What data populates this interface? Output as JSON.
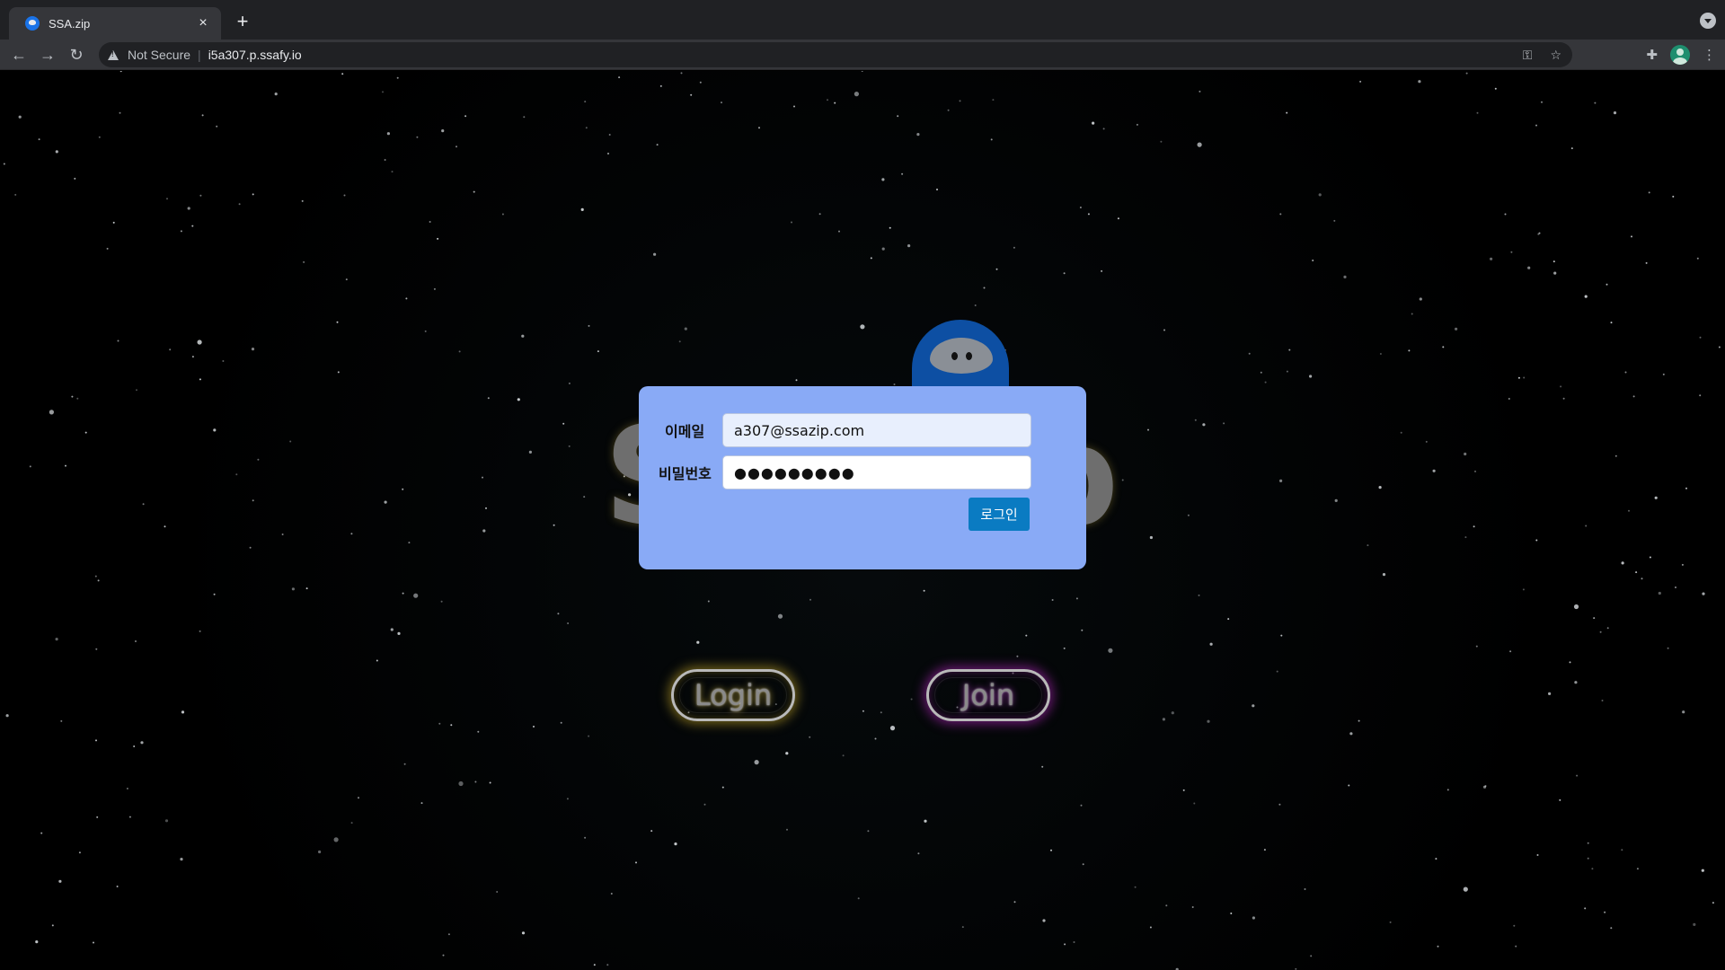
{
  "browser": {
    "tab_title": "SSA.zip",
    "tab_close": "×",
    "new_tab": "+",
    "security_label": "Not Secure",
    "url": "i5a307.p.ssafy.io"
  },
  "login_form": {
    "email_label": "이메일",
    "email_value": "a307@ssazip.com",
    "password_label": "비밀번호",
    "password_value": "●●●●●●●●●",
    "submit_label": "로그인"
  },
  "buttons": {
    "login_label": "Login",
    "join_label": "Join"
  },
  "colors": {
    "modal_bg": "#89aaf6",
    "submit_bg": "#0a7bc2",
    "login_glow": "#c8aa28",
    "join_glow": "#be28c8",
    "ghost": "#0d4fa3"
  }
}
